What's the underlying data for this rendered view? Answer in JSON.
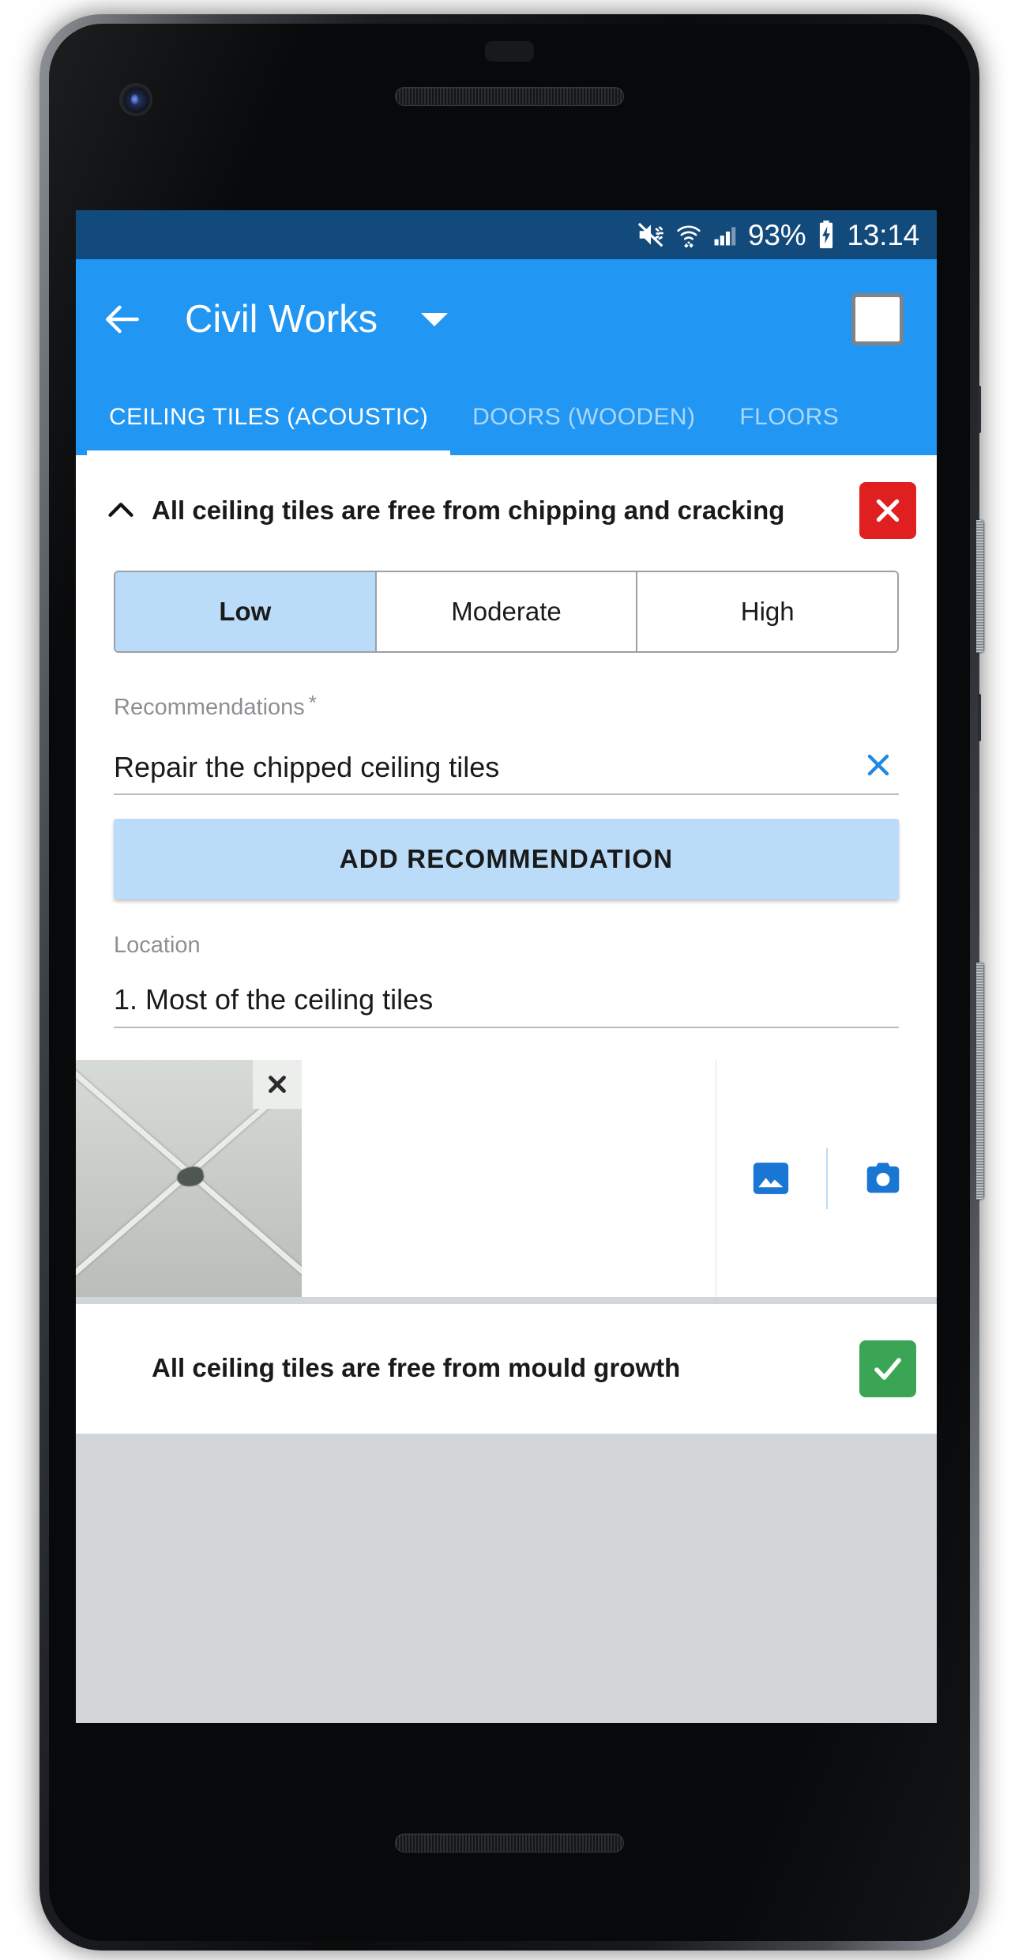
{
  "status_bar": {
    "battery_percent": "93%",
    "time": "13:14",
    "icons": [
      "mute-icon",
      "wifi-icon",
      "cellular-signal-icon",
      "battery-charging-icon"
    ],
    "background_color": "#134a7c"
  },
  "app_bar": {
    "back_icon": "arrow-left-icon",
    "title": "Civil Works",
    "dropdown_icon": "caret-down-icon",
    "select_all_checkbox": "unchecked",
    "background_color": "#2196f3"
  },
  "tabs": {
    "items": [
      {
        "label": "CEILING TILES (ACOUSTIC)",
        "active": true
      },
      {
        "label": "DOORS (WOODEN)",
        "active": false
      },
      {
        "label": "FLOORS",
        "active": false
      }
    ]
  },
  "questions": [
    {
      "text": "All ceiling tiles are free from chipping and cracking",
      "expanded": true,
      "status": "fail",
      "status_icon": "cross-icon",
      "status_color": "#e02020",
      "chevron_icon": "chevron-up-icon",
      "severity": {
        "options": [
          "Low",
          "Moderate",
          "High"
        ],
        "selected": "Low"
      },
      "recommendations": {
        "label": "Recommendations",
        "required_marker": "*",
        "value": "Repair the chipped ceiling tiles",
        "clear_icon": "close-x-icon",
        "add_button_label": "ADD RECOMMENDATION"
      },
      "location": {
        "label": "Location",
        "value": "1. Most of the ceiling tiles"
      },
      "attachments": {
        "photo_alt": "ceiling-tile-photo",
        "remove_icon": "close-x-icon",
        "gallery_icon": "image-icon",
        "camera_icon": "camera-icon"
      }
    },
    {
      "text": "All ceiling tiles are free from mould growth",
      "expanded": false,
      "status": "pass",
      "status_icon": "check-icon",
      "status_color": "#3aa655"
    }
  ],
  "theme": {
    "accent": "#2196f3",
    "accent_light": "#badcf9",
    "status_bar_bg": "#134a7c",
    "page_bg": "#d3d6d8"
  }
}
